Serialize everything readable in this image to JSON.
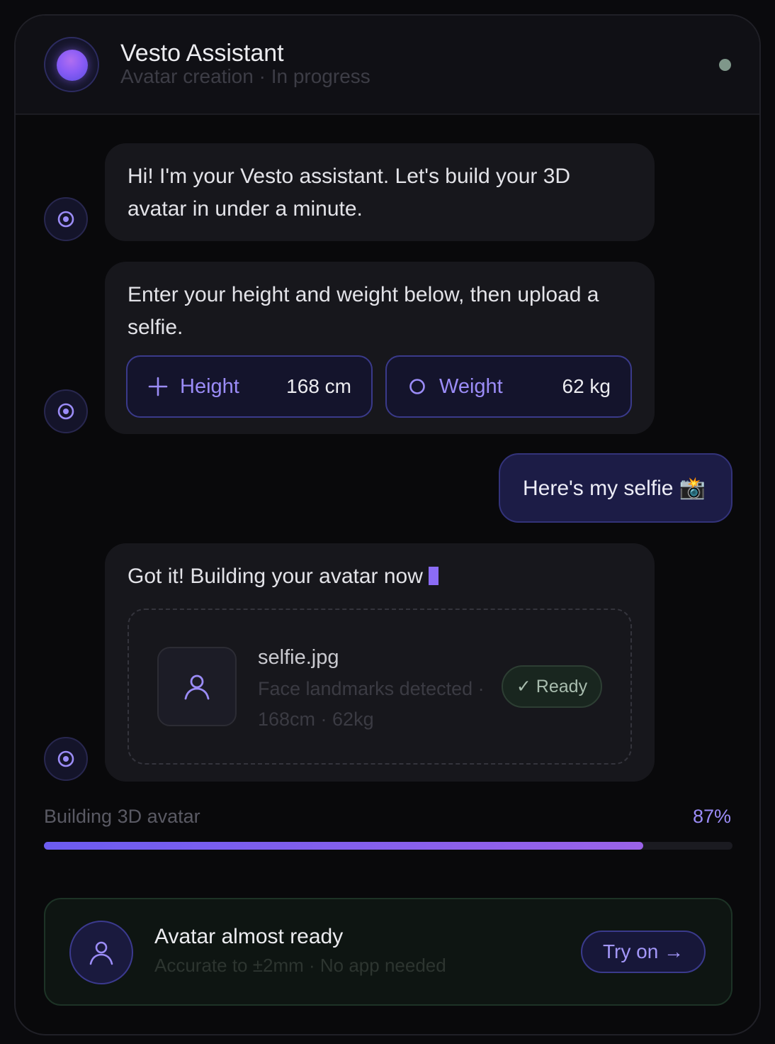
{
  "header": {
    "title": "Vesto Assistant",
    "subtitle": "Avatar creation · In progress"
  },
  "messages": [
    {
      "from": "assistant",
      "text": "Hi! I'm your Vesto assistant. Let's build your 3D avatar in under a minute."
    },
    {
      "from": "assistant",
      "text": "Enter your height and weight below, then upload a selfie."
    },
    {
      "from": "user",
      "text": "Here's my selfie 📸"
    },
    {
      "from": "assistant",
      "text": "Got it! Building your avatar now"
    }
  ],
  "measurements": {
    "height_label": "Height",
    "height_value": "168 cm",
    "weight_label": "Weight",
    "weight_value": "62 kg"
  },
  "upload": {
    "filename": "selfie.jpg",
    "description": "Face landmarks detected · 168cm · 62kg",
    "status": "✓ Ready"
  },
  "progress": {
    "label": "Building 3D avatar",
    "percent_text": "87%",
    "fraction": 0.87
  },
  "cta": {
    "title": "Avatar almost ready",
    "subtitle": "Accurate to ±2mm · No app needed",
    "button": "Try on →"
  },
  "colors": {
    "accent": "#8b6cf5",
    "status_online": "#7f978a",
    "ready_green": "#a8bcae"
  }
}
